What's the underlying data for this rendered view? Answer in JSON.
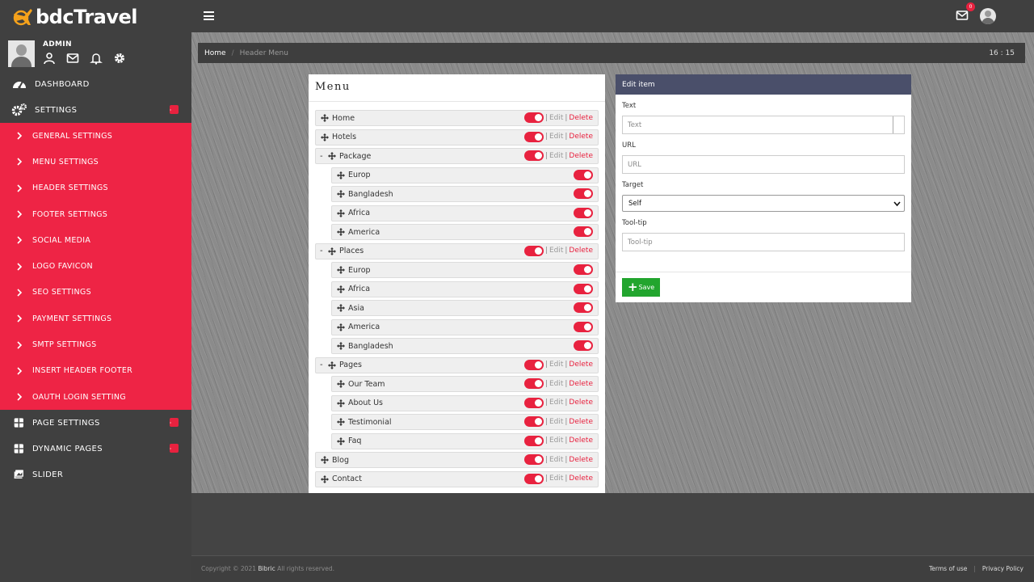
{
  "brand": {
    "name": "bdcTravel"
  },
  "user": {
    "name": "ADMIN"
  },
  "topbar": {
    "mail_count": "0"
  },
  "nav": {
    "dashboard": "DASHBOARD",
    "settings": "SETTINGS",
    "settings_items": [
      "GENERAL SETTINGS",
      "MENU SETTINGS",
      "HEADER SETTINGS",
      "FOOTER SETTINGS",
      "SOCIAL MEDIA",
      "LOGO FAVICON",
      "SEO SETTINGS",
      "PAYMENT SETTINGS",
      "SMTP SETTINGS",
      "INSERT HEADER FOOTER",
      "OAUTH LOGIN SETTING"
    ],
    "page_settings": "PAGE SETTINGS",
    "dynamic_pages": "DYNAMIC PAGES",
    "slider": "SLIDER"
  },
  "breadcrumb": {
    "home": "Home",
    "current": "Header Menu",
    "time": "16 : 15"
  },
  "menu": {
    "title": "Menu",
    "edit_label": "Edit",
    "delete_label": "Delete",
    "items": [
      {
        "label": "Home"
      },
      {
        "label": "Hotels"
      },
      {
        "label": "Package",
        "collapse": "-",
        "children": [
          "Europ",
          "Bangladesh",
          "Africa",
          "America"
        ]
      },
      {
        "label": "Places",
        "collapse": "-",
        "children": [
          "Europ",
          "Africa",
          "Asia",
          "America",
          "Bangladesh"
        ]
      },
      {
        "label": "Pages",
        "collapse": "-",
        "children": [
          "Our Team",
          "About Us",
          "Testimonial",
          "Faq"
        ],
        "children_actions": true
      },
      {
        "label": "Blog"
      },
      {
        "label": "Contact"
      }
    ]
  },
  "edit_item": {
    "header": "Edit item",
    "text_label": "Text",
    "text_placeholder": "Text",
    "url_label": "URL",
    "url_placeholder": "URL",
    "target_label": "Target",
    "target_value": "Self",
    "tooltip_label": "Tool-tip",
    "tooltip_placeholder": "Tool-tip",
    "save_label": "Save"
  },
  "footer": {
    "copyright_prefix": "Copyright © 2021",
    "company": "Bibric",
    "rights": "All rights reserved.",
    "terms": "Terms of use",
    "privacy": "Privacy Policy"
  },
  "colors": {
    "accent": "#ee2445",
    "sidebar": "#404040",
    "edit_header": "#4a4f6a",
    "save": "#22a52e"
  }
}
